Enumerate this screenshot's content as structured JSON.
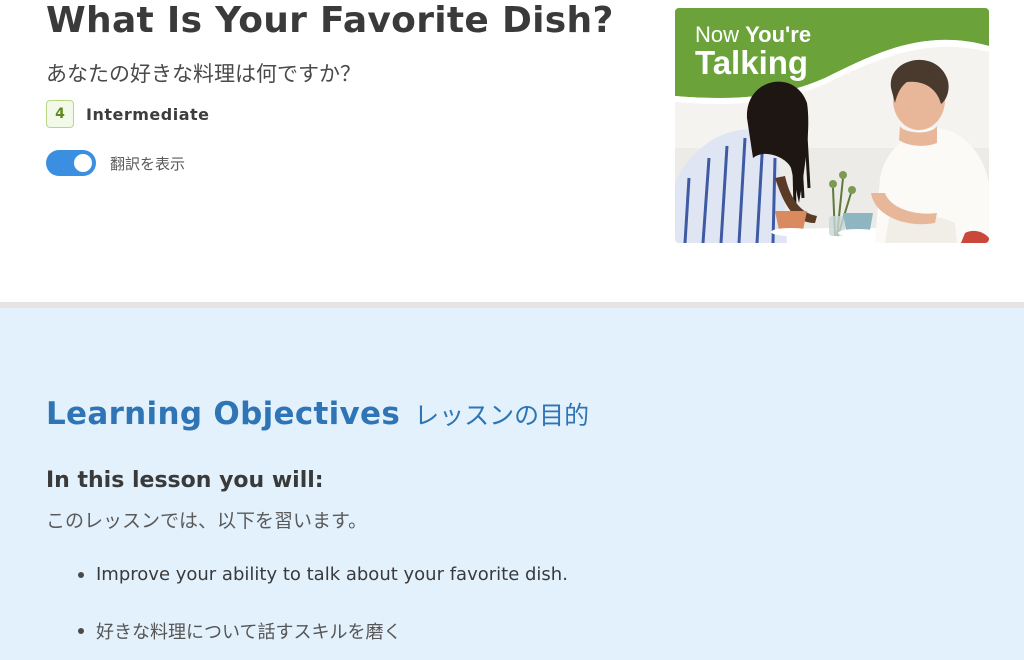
{
  "header": {
    "title": "What Is Your Favorite Dish?",
    "subtitle_ja": "あなたの好きな料理は何ですか？",
    "level_number": "4",
    "level_label": "Intermediate",
    "translation_toggle_label": "翻訳を表示",
    "translation_toggle_on": true
  },
  "thumbnail": {
    "line1_light": "Now ",
    "line1_bold": "You're",
    "line2": "Talking"
  },
  "objectives": {
    "heading_en": "Learning Objectives",
    "heading_ja": "レッスンの目的",
    "intro_en": "In this lesson you will:",
    "intro_ja": "このレッスンでは、以下を習います。",
    "items": [
      "Improve your ability to talk about your favorite dish.",
      "好きな料理について話すスキルを磨く"
    ]
  },
  "colors": {
    "accent_blue": "#2f75b5",
    "toggle_blue": "#3b8fe0",
    "level_green": "#5e8a1e",
    "banner_green": "#6ba33a",
    "section_bg": "#e3f1fd"
  }
}
